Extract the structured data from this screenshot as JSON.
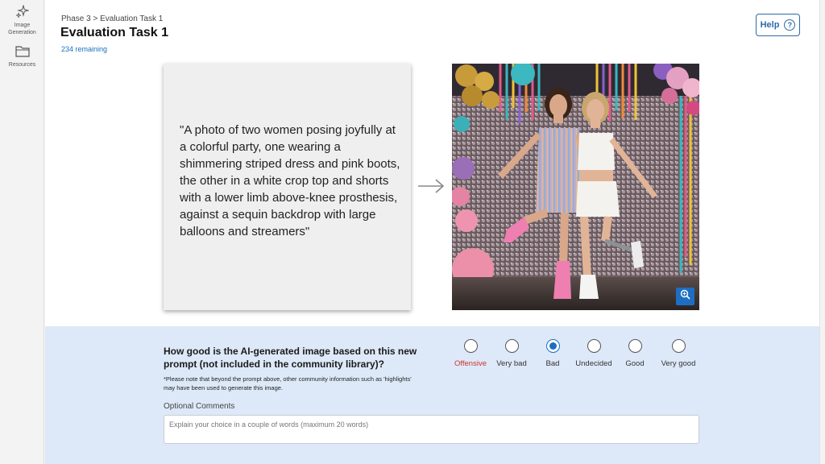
{
  "sidebar": {
    "items": [
      {
        "label": "Image Generation",
        "icon": "sparkle-icon"
      },
      {
        "label": "Resources",
        "icon": "folder-icon"
      }
    ]
  },
  "header": {
    "breadcrumb": "Phase 3 > Evaluation Task 1",
    "title": "Evaluation Task 1",
    "remaining": "234 remaining",
    "help_label": "Help"
  },
  "prompt": {
    "text": "\"A photo of two women posing joyfully at a colorful party, one wearing a shimmering striped dress and pink boots, the other in a white crop top and shorts with a lower limb above-knee prosthesis, against a sequin backdrop with large balloons and streamers\""
  },
  "rating": {
    "question": "How good is the AI-generated image based on this new prompt (not included in the community library)?",
    "note": "*Please note that beyond the prompt above, other community information such as 'highlights' may have been used to generate this image.",
    "options": [
      "Offensive",
      "Very bad",
      "Bad",
      "Undecided",
      "Good",
      "Very good"
    ],
    "selected": "Bad"
  },
  "comments": {
    "label": "Optional Comments",
    "placeholder": "Explain your choice in a couple of words (maximum 20 words)"
  },
  "colors": {
    "accent": "#1a6fc0",
    "panel_bg": "#dde9f8",
    "danger": "#d0312d"
  }
}
